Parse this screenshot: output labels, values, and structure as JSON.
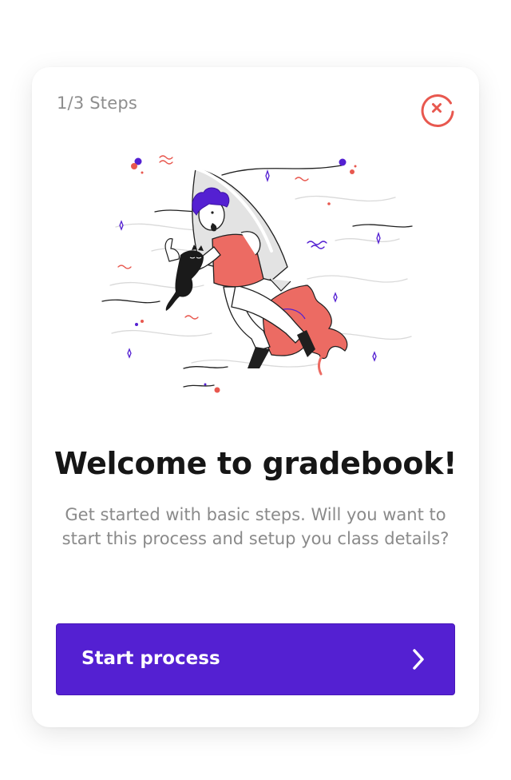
{
  "onboarding": {
    "step_indicator": "1/3 Steps",
    "title": "Welcome to gradebook!",
    "description": "Get started with basic steps. Will you want to start this process and setup you class details?",
    "cta_label": "Start process"
  },
  "icons": {
    "close": "close-circle-icon",
    "arrow": "chevron-right-icon"
  },
  "colors": {
    "primary": "#5420d2",
    "accent": "#e8584f",
    "title": "#161616",
    "muted": "#8a8a8a"
  }
}
